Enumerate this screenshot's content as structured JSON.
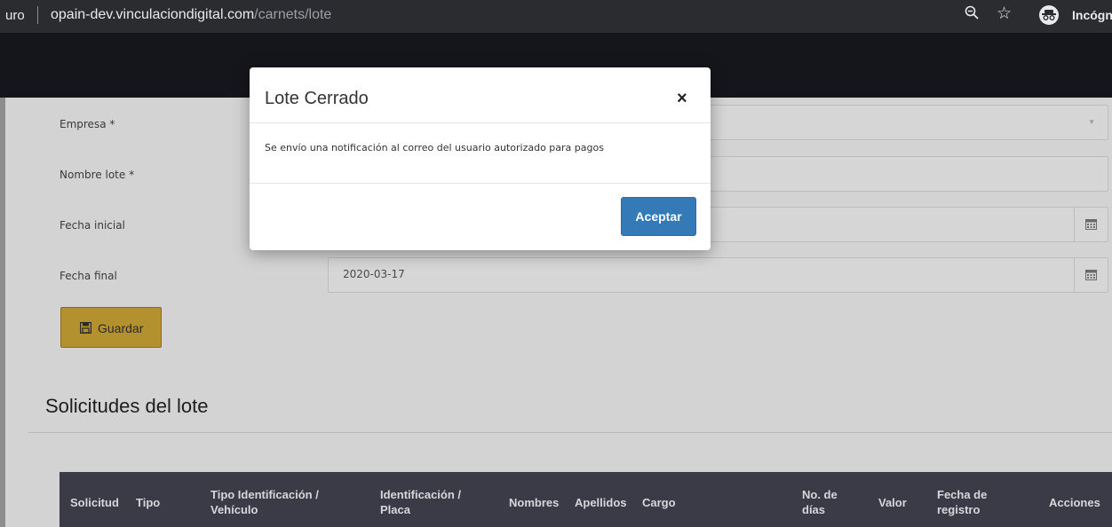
{
  "browser": {
    "url_left": "uro",
    "url_host": "opain-dev.vinculaciondigital.com",
    "url_path": "/carnets/lote",
    "incognito_label": "Incógn",
    "zoom_icon": "zoom-icon",
    "star_icon": "star-icon",
    "incognito_icon": "incognito-icon"
  },
  "form": {
    "empresa_label": "Empresa *",
    "nombre_label": "Nombre lote *",
    "fecha_inicial_label": "Fecha inicial",
    "fecha_final_label": "Fecha final",
    "fecha_final_value": "2020-03-17",
    "guardar_label": "Guardar"
  },
  "section": {
    "title": "Solicitudes del lote"
  },
  "table": {
    "headers": [
      "Solicitud",
      "Tipo",
      "Tipo Identificación /",
      "Vehículo",
      "Identificación /",
      "Placa",
      "Nombres",
      "Apellidos",
      "Cargo",
      "No. de",
      "días",
      "Valor",
      "Fecha de",
      "registro",
      "Acciones"
    ]
  },
  "modal": {
    "title": "Lote Cerrado",
    "close": "×",
    "body": "Se envío una notificación al correo del usuario autorizado para pagos",
    "accept_label": "Aceptar"
  },
  "colors": {
    "accent": "#337ab7",
    "guardar": "#b4912f",
    "table_header": "#3b3b47"
  }
}
